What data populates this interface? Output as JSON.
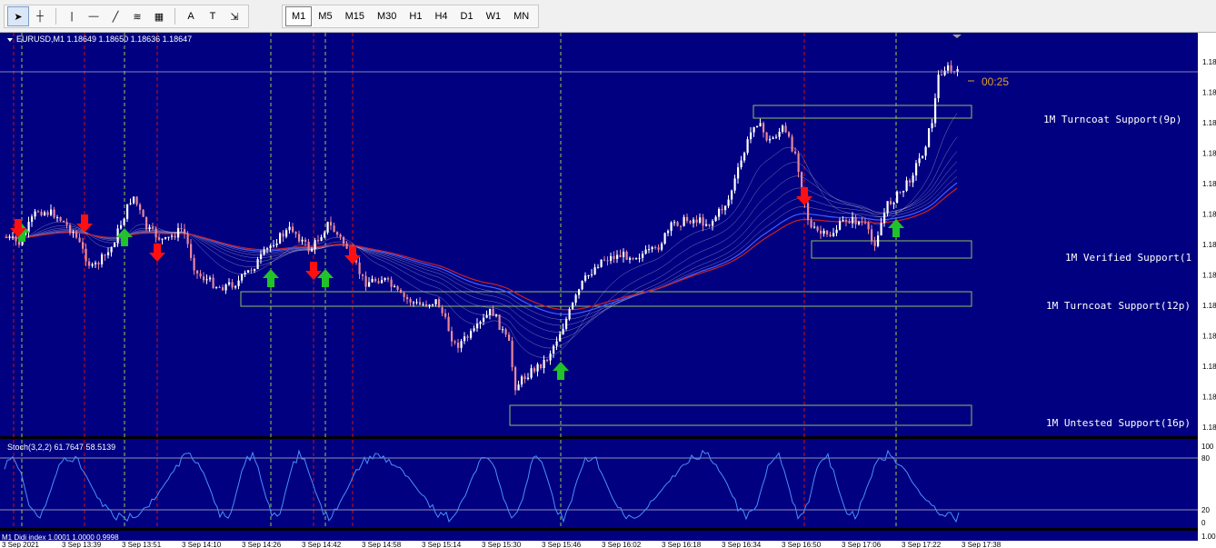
{
  "toolbar": {
    "tools": [
      {
        "name": "cursor-tool",
        "icon": "cursor-icon",
        "glyph": "➤"
      },
      {
        "name": "crosshair-tool",
        "icon": "crosshair-icon",
        "glyph": "┼"
      },
      {
        "name": "vertical-line-tool",
        "icon": "vertical-line-icon",
        "glyph": "|"
      },
      {
        "name": "horizontal-line-tool",
        "icon": "horizontal-line-icon",
        "glyph": "—"
      },
      {
        "name": "trendline-tool",
        "icon": "trendline-icon",
        "glyph": "╱"
      },
      {
        "name": "fibonacci-tool",
        "icon": "fibonacci-icon",
        "glyph": "≋"
      },
      {
        "name": "channels-tool",
        "icon": "channels-icon",
        "glyph": "▦"
      },
      {
        "name": "text-tool",
        "icon": "text-icon",
        "glyph": "A"
      },
      {
        "name": "text-label-tool",
        "icon": "text-label-icon",
        "glyph": "T"
      },
      {
        "name": "arrows-tool",
        "icon": "arrows-icon",
        "glyph": "⇲"
      }
    ],
    "timeframes": [
      "M1",
      "M5",
      "M15",
      "M30",
      "H1",
      "H4",
      "D1",
      "W1",
      "MN"
    ],
    "active_timeframe": "M1"
  },
  "chart": {
    "header": "EURUSD,M1  1.18649 1.18650 1.18636 1.18647",
    "countdown": "00:25",
    "price_labels": [
      "1.18",
      "1.18",
      "1.18",
      "1.18",
      "1.18",
      "1.18",
      "1.18",
      "1.18",
      "1.18",
      "1.18",
      "1.18",
      "1.18",
      "1.18"
    ],
    "zones": [
      {
        "label": "1M Turncoat Support(9p)"
      },
      {
        "label": "1M Verified Support(1"
      },
      {
        "label": "1M Turncoat Support(12p)"
      },
      {
        "label": "1M Untested Support(16p)"
      }
    ],
    "stoch_header": "Stoch(3,2,2) 61.7647 58.5139",
    "stoch_levels": [
      "100",
      "80",
      "20",
      "0"
    ],
    "didi_header": "M1 Didi index 1.0001 1.0000 0.9998",
    "didi_level": "1.00",
    "time_labels": [
      "3 Sep 2021",
      "3 Sep 13:39",
      "3 Sep 13:51",
      "3 Sep 14:10",
      "3 Sep 14:26",
      "3 Sep 14:42",
      "3 Sep 14:58",
      "3 Sep 15:14",
      "3 Sep 15:30",
      "3 Sep 15:46",
      "3 Sep 16:02",
      "3 Sep 16:18",
      "3 Sep 16:34",
      "3 Sep 16:50",
      "3 Sep 17:06",
      "3 Sep 17:22",
      "3 Sep 17:38"
    ]
  },
  "colors": {
    "background": "#000080",
    "bull_candle": "#ffffff",
    "bear_candle": "#e8889a",
    "zone_border": "#8fbf5f",
    "stoch_line": "#4a90ff",
    "red_line": "#d01010",
    "green_vline": "#9fc84a",
    "buy_arrow": "#22c22a",
    "sell_arrow": "#ff1010"
  }
}
